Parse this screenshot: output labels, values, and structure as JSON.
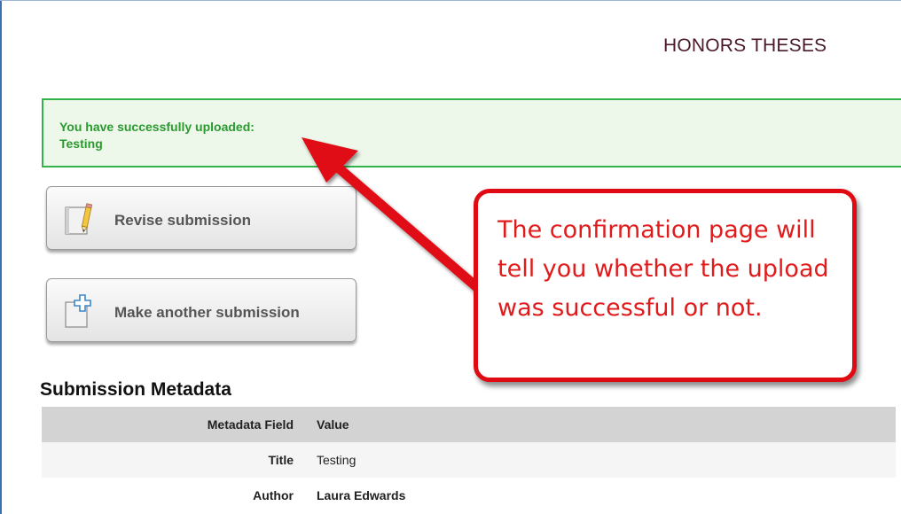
{
  "header": {
    "title": "HONORS THESES"
  },
  "alert": {
    "line1": "You have successfully uploaded:",
    "line2": "Testing"
  },
  "actions": {
    "revise_label": "Revise submission",
    "another_label": "Make another submission"
  },
  "callout": {
    "text": "The confirmation page will tell you whether the upload was successful or not."
  },
  "metadata": {
    "heading": "Submission Metadata",
    "columns": [
      "Metadata Field",
      "Value"
    ],
    "rows": [
      {
        "field": "Title",
        "value": "Testing"
      },
      {
        "field": "Author",
        "value": "Laura Edwards"
      }
    ]
  },
  "colors": {
    "success_border": "#2fb34a",
    "success_text": "#2a9a2f",
    "callout_red": "#e00b12",
    "header_text": "#4a1a2c"
  },
  "icons": {
    "revise": "pencil-document-icon",
    "another": "add-document-icon"
  }
}
